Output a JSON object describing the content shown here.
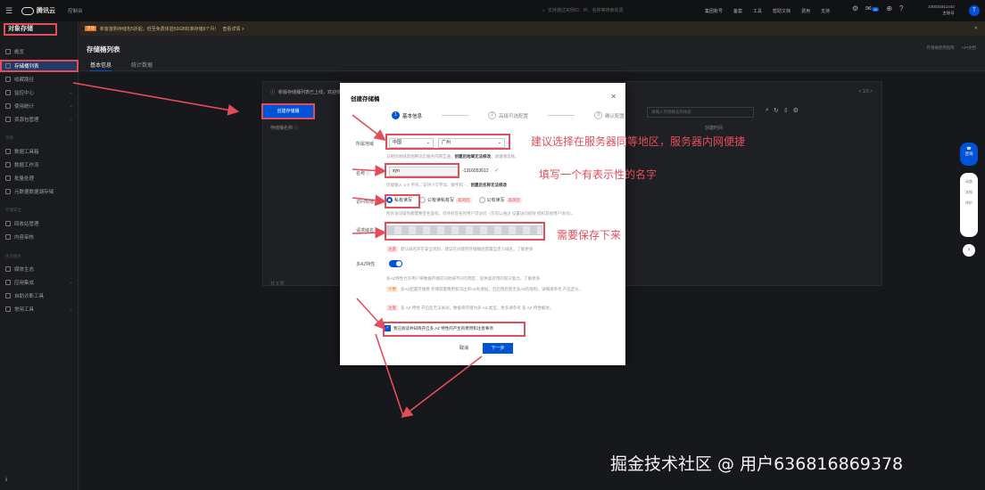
{
  "topbar": {
    "brand": "腾讯云",
    "console": "控制台",
    "search_placeholder": "支持通过实例ID、IP、名称等搜索资源",
    "nav": [
      "集团账号",
      "备案",
      "工具",
      "帮助文档",
      "费用",
      "支持"
    ],
    "notification_count": "10",
    "account_id": "100031911442",
    "account_role": "主账号",
    "avatar_letter": "T"
  },
  "sidebar": {
    "product_title": "对象存储",
    "items": [
      {
        "label": "概览"
      },
      {
        "label": "存储桶列表"
      },
      {
        "label": "收藏路径"
      },
      {
        "label": "监控中心"
      },
      {
        "label": "使用统计"
      },
      {
        "label": "资源包管理"
      }
    ],
    "group1": "功能",
    "items2": [
      {
        "label": "数据工具箱"
      },
      {
        "label": "数据工作流"
      },
      {
        "label": "批量处理"
      },
      {
        "label": "元数据数据湖存储"
      }
    ],
    "group2": "存储安全",
    "items3": [
      {
        "label": "回收站管理"
      },
      {
        "label": "内容审核"
      }
    ],
    "group3": "生态服务",
    "items4": [
      {
        "label": "媒体生态"
      },
      {
        "label": "应用集成"
      },
      {
        "label": "自助诊断工具"
      },
      {
        "label": "常用工具"
      }
    ],
    "bottom_label": "ℹ"
  },
  "banner": {
    "tag": "活动",
    "text": "新客首购存储包5折起，低至免费体验50GB标准存储6个月！",
    "link": "查看详情 >"
  },
  "page": {
    "title": "存储桶列表",
    "links": [
      "存储桶使用指南",
      "API文档"
    ],
    "tabs": [
      "基本信息",
      "统计数据"
    ]
  },
  "list": {
    "notice": "新版存储桶列表已上线，欢迎体验",
    "pager": "< 1/3 >",
    "create_button": "创建存储桶",
    "search_placeholder": "请输入存储桶名称搜索",
    "column_name": "存储桶名称 ⓘ",
    "column_time": "创建时间",
    "row_count": "共 3 项"
  },
  "dialog": {
    "title": "创建存储桶",
    "steps": [
      {
        "num": "1",
        "label": "基本信息"
      },
      {
        "num": "2",
        "label": "高级可选配置"
      },
      {
        "num": "3",
        "label": "确认配置"
      }
    ],
    "region_label": "所属地域",
    "region_country": "中国",
    "region_city": "广州",
    "region_hint": "与相同地域其他腾讯云服务内网互通，",
    "region_hint_bold": "创建后地域无法修改",
    "region_hint_tail": "，请谨慎选择。",
    "name_label": "名称 ⓘ",
    "name_value": "xyn",
    "name_suffix": "-1316053612",
    "name_hint": "仅能输入 1-X 字符，支持小写字母、数字和 - ，",
    "name_hint_bold": "创建后名称无法修改",
    "access_label": "访问权限",
    "access_options": [
      {
        "label": "私有读写",
        "risk": ""
      },
      {
        "label": "公有读私有写",
        "risk": "高风险"
      },
      {
        "label": "公有读写",
        "risk": "高风险"
      }
    ],
    "access_hint": "所有访问操作都需要签名鉴权，仅持有签名的用户可访问（仅可以通过 设置访问权限 授权其他用户访问）。",
    "domain_label": "请求域名",
    "domain_tag": "注意",
    "domain_hint": "默认域名存在安全风险，建议在创建完存储桶后配置自定义域名，了解更多",
    "maz_label": "多AZ特性",
    "maz_hint": "多AZ特性允许用户将数据存储在同地域不同可用区，提供高可用的容灾能力，了解更多",
    "maz_fee_tag": "计费",
    "maz_fee": "多AZ配置存储费 存储容量费用和流出单AZ有增加，且启用后暂无多AZ的限制，详细请参考 产品定价。",
    "maz_note_tag": "注意",
    "maz_note": "多 AZ 特性 开启后无法关闭，数据将存储为多 AZ 类型，更多请参考 多 AZ 特性概述。",
    "agree_text": "我已阅读并知晓开启多 AZ 特性的产生的费用和注意事项",
    "cancel_button": "取消",
    "next_button": "下一步"
  },
  "annotations": {
    "region": "建议选择在服务器同等地区，服务器内网便捷",
    "name": "填写一个有表示性的名字",
    "domain": "需要保存下来"
  },
  "float_bar": {
    "main": "咨询",
    "items": [
      "动态",
      "文档",
      "评价"
    ],
    "arrow": "›"
  },
  "watermark": "掘金技术社区 @ 用户636816869378",
  "colors": {
    "accent": "#0052d9",
    "annotation": "#e34d59"
  }
}
